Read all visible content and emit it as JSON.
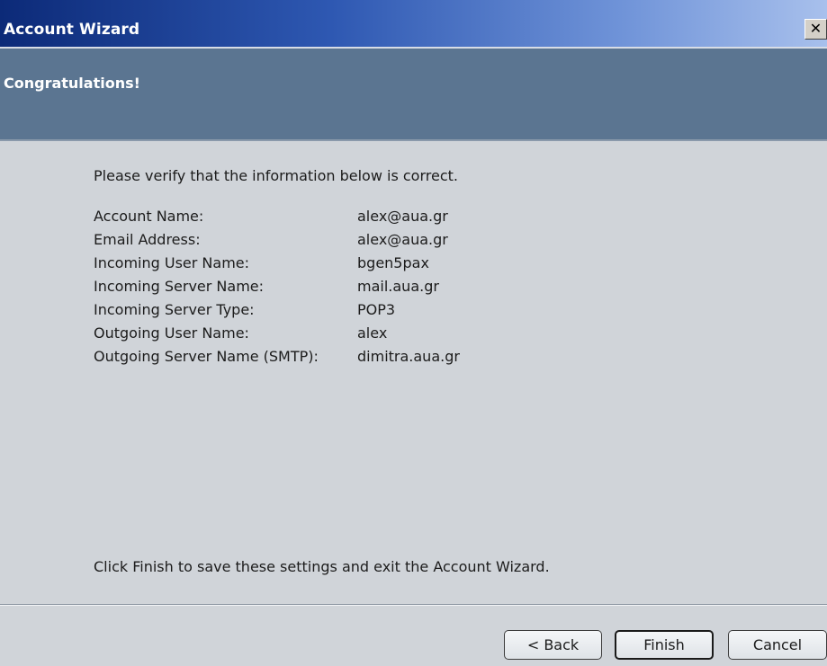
{
  "window": {
    "title": "Account Wizard",
    "close_glyph": "✕"
  },
  "banner": {
    "heading": "Congratulations!"
  },
  "content": {
    "intro": "Please verify that the information below is correct.",
    "rows": [
      {
        "label": "Account Name:",
        "value": "alex@aua.gr"
      },
      {
        "label": "Email Address:",
        "value": "alex@aua.gr"
      },
      {
        "label": "Incoming User Name:",
        "value": "bgen5pax"
      },
      {
        "label": "Incoming Server Name:",
        "value": "mail.aua.gr"
      },
      {
        "label": "Incoming Server Type:",
        "value": "POP3"
      },
      {
        "label": "Outgoing User Name:",
        "value": "alex"
      },
      {
        "label": "Outgoing Server Name (SMTP):",
        "value": "dimitra.aua.gr"
      }
    ],
    "footer_note": "Click Finish to save these settings and exit the Account Wizard."
  },
  "buttons": {
    "back": "< Back",
    "finish": "Finish",
    "cancel": "Cancel"
  },
  "colors": {
    "banner": "#5b7591",
    "body": "#d0d4d9",
    "titlebar_start": "#0c2a78",
    "titlebar_end": "#a8c0ec"
  },
  "icons": {
    "close": "close-icon"
  }
}
